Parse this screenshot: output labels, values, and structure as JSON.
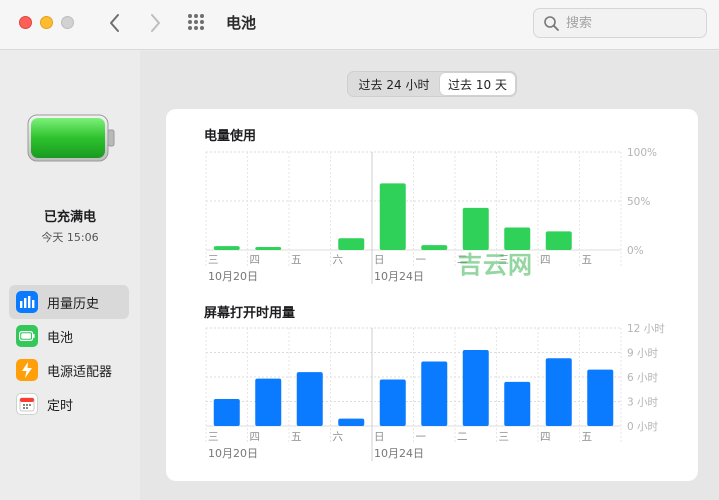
{
  "window": {
    "title": "电池",
    "search_placeholder": "搜索"
  },
  "sidebar": {
    "status": "已充满电",
    "status_time": "今天 15:06",
    "items": [
      {
        "label": "用量历史",
        "icon": "chart-bar-icon",
        "active": true
      },
      {
        "label": "电池",
        "icon": "battery-icon",
        "active": false
      },
      {
        "label": "电源适配器",
        "icon": "bolt-icon",
        "active": false
      },
      {
        "label": "定时",
        "icon": "calendar-icon",
        "active": false
      }
    ]
  },
  "segmented": {
    "options": [
      "过去 24 小时",
      "过去 10 天"
    ],
    "selected": 1
  },
  "colors": {
    "battery_green": "#2fd158",
    "screen_blue": "#0a7aff",
    "orange": "#ff9f0a"
  },
  "watermark": "吉云网",
  "chart_data": [
    {
      "type": "bar",
      "title": "电量使用",
      "categories": [
        "三",
        "四",
        "五",
        "六",
        "日",
        "一",
        "二",
        "三",
        "四",
        "五"
      ],
      "date_labels": [
        {
          "index": 0,
          "text": "10月20日"
        },
        {
          "index": 4,
          "text": "10月24日"
        }
      ],
      "values": [
        4,
        3,
        0,
        12,
        68,
        5,
        43,
        23,
        19,
        0
      ],
      "ylim": [
        0,
        100
      ],
      "yticks": [
        "100%",
        "50%",
        "0%"
      ],
      "yunit": "%"
    },
    {
      "type": "bar",
      "title": "屏幕打开时用量",
      "categories": [
        "三",
        "四",
        "五",
        "六",
        "日",
        "一",
        "二",
        "三",
        "四",
        "五"
      ],
      "date_labels": [
        {
          "index": 0,
          "text": "10月20日"
        },
        {
          "index": 4,
          "text": "10月24日"
        }
      ],
      "values": [
        3.3,
        5.8,
        6.6,
        0.9,
        5.7,
        7.9,
        9.3,
        5.4,
        8.3,
        6.9
      ],
      "ylim": [
        0,
        12
      ],
      "yticks": [
        "12 小时",
        "9 小时",
        "6 小时",
        "3 小时",
        "0 小时"
      ],
      "yunit": "小时"
    }
  ]
}
